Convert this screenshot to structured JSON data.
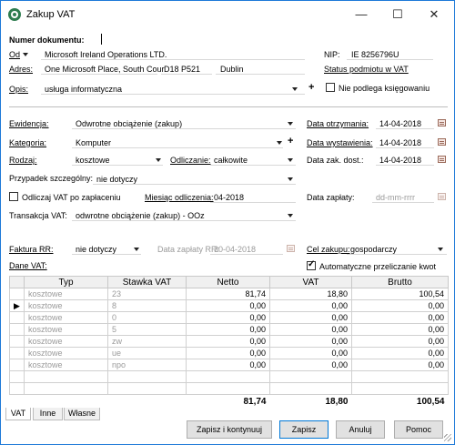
{
  "window": {
    "title": "Zakup VAT"
  },
  "header": {
    "doc_number_label": "Numer dokumentu:",
    "doc_number_value": "",
    "from_label": "Od",
    "from_value": "Microsoft Ireland Operations LTD.",
    "nip_label": "NIP:",
    "nip_value": "IE 8256796U",
    "address_label": "Adres:",
    "address_street": "One Microsoft Place, South Cour",
    "address_postcode": "D18 P521",
    "address_city": "Dublin",
    "vat_status_link": "Status podmiotu w VAT",
    "description_label": "Opis:",
    "description_value": "usługa informatyczna",
    "no_booking_label": "Nie podlega księgowaniu"
  },
  "form": {
    "ewidencja_label": "Ewidencja:",
    "ewidencja_value": "Odwrotne obciążenie (zakup)",
    "kategoria_label": "Kategoria:",
    "kategoria_value": "Komputer",
    "rodzaj_label": "Rodzaj:",
    "rodzaj_value": "kosztowe",
    "odliczanie_label": "Odliczanie:",
    "odliczanie_value": "całkowite",
    "przypadek_label": "Przypadek szczególny:",
    "przypadek_value": "nie dotyczy",
    "odliczaj_label": "Odliczaj VAT po zapłaceniu",
    "miesiac_label": "Miesiąc odliczenia:",
    "miesiac_value": "04-2018",
    "transakcja_label": "Transakcja VAT:",
    "transakcja_value": "odwrotne obciążenie (zakup) - OOz",
    "data_otrzymania_label": "Data otrzymania:",
    "data_otrzymania_value": "14-04-2018",
    "data_wystawienia_label": "Data wystawienia:",
    "data_wystawienia_value": "14-04-2018",
    "data_zak_label": "Data zak. dost.:",
    "data_zak_value": "14-04-2018",
    "data_zaplaty_label": "Data zapłaty:",
    "data_zaplaty_placeholder": "dd-mm-rrrr",
    "faktura_rr_label": "Faktura RR:",
    "faktura_rr_value": "nie dotyczy",
    "data_zaplaty_rr_label": "Data zapłaty RR:",
    "data_zaplaty_rr_value": "30-04-2018",
    "cel_zakupu_label": "Cel zakupu:",
    "cel_zakupu_value": "gospodarczy",
    "dane_vat_label": "Dane VAT:",
    "auto_calc_label": "Automatyczne przeliczanie kwot"
  },
  "table": {
    "columns": [
      "Typ",
      "Stawka VAT",
      "Netto",
      "VAT",
      "Brutto"
    ],
    "rows": [
      {
        "typ": "kosztowe",
        "stawka": "23",
        "netto": "81,74",
        "vat": "18,80",
        "brutto": "100,54"
      },
      {
        "typ": "kosztowe",
        "stawka": "8",
        "netto": "0,00",
        "vat": "0,00",
        "brutto": "0,00"
      },
      {
        "typ": "kosztowe",
        "stawka": "0",
        "netto": "0,00",
        "vat": "0,00",
        "brutto": "0,00"
      },
      {
        "typ": "kosztowe",
        "stawka": "5",
        "netto": "0,00",
        "vat": "0,00",
        "brutto": "0,00"
      },
      {
        "typ": "kosztowe",
        "stawka": "zw",
        "netto": "0,00",
        "vat": "0,00",
        "brutto": "0,00"
      },
      {
        "typ": "kosztowe",
        "stawka": "ue",
        "netto": "0,00",
        "vat": "0,00",
        "brutto": "0,00"
      },
      {
        "typ": "kosztowe",
        "stawka": "npo",
        "netto": "0,00",
        "vat": "0,00",
        "brutto": "0,00"
      }
    ],
    "totals": {
      "netto": "81,74",
      "vat": "18,80",
      "brutto": "100,54"
    }
  },
  "tabs": [
    "VAT",
    "Inne",
    "Własne"
  ],
  "buttons": {
    "save_continue": "Zapisz i kontynuuj",
    "save": "Zapisz",
    "cancel": "Anuluj",
    "help": "Pomoc"
  }
}
